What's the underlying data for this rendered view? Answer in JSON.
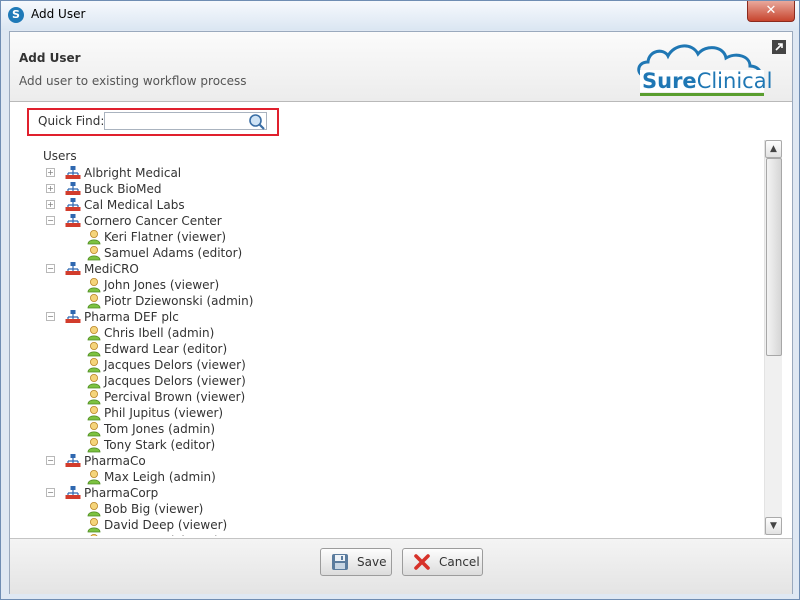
{
  "window": {
    "title": "Add User",
    "close_glyph": "✕"
  },
  "header": {
    "title": "Add User",
    "subtitle": "Add user to existing workflow process",
    "logo": {
      "text": "SureClinical",
      "color_blue": "#1f77b4",
      "color_green": "#5a9e2f"
    }
  },
  "quick_find": {
    "label": "Quick Find:",
    "value": "",
    "placeholder": ""
  },
  "tree": {
    "root_label": "Users",
    "groups": [
      {
        "name": "Albright Medical",
        "expanded": false,
        "users": []
      },
      {
        "name": "Buck BioMed",
        "expanded": false,
        "users": []
      },
      {
        "name": "Cal Medical Labs",
        "expanded": false,
        "users": []
      },
      {
        "name": "Cornero Cancer Center",
        "expanded": true,
        "users": [
          "Keri Flatner (viewer)",
          "Samuel Adams (editor)"
        ]
      },
      {
        "name": "MediCRO",
        "expanded": true,
        "users": [
          "John Jones (viewer)",
          "Piotr Dziewonski (admin)"
        ]
      },
      {
        "name": "Pharma DEF plc",
        "expanded": true,
        "users": [
          "Chris Ibell (admin)",
          "Edward Lear (editor)",
          "Jacques Delors (viewer)",
          "Jacques Delors (viewer)",
          "Percival Brown (viewer)",
          "Phil Jupitus (viewer)",
          "Tom Jones (admin)",
          "Tony Stark (editor)"
        ]
      },
      {
        "name": "PharmaCo",
        "expanded": true,
        "users": [
          "Max Leigh (admin)"
        ]
      },
      {
        "name": "PharmaCorp",
        "expanded": true,
        "users": [
          "Bob Big (viewer)",
          "David Deep (viewer)",
          "Eve Evans (viewer)"
        ]
      }
    ]
  },
  "footer": {
    "save_label": "Save",
    "cancel_label": "Cancel"
  },
  "colors": {
    "highlight_border": "#e0202d",
    "accent": "#1f77b4"
  }
}
